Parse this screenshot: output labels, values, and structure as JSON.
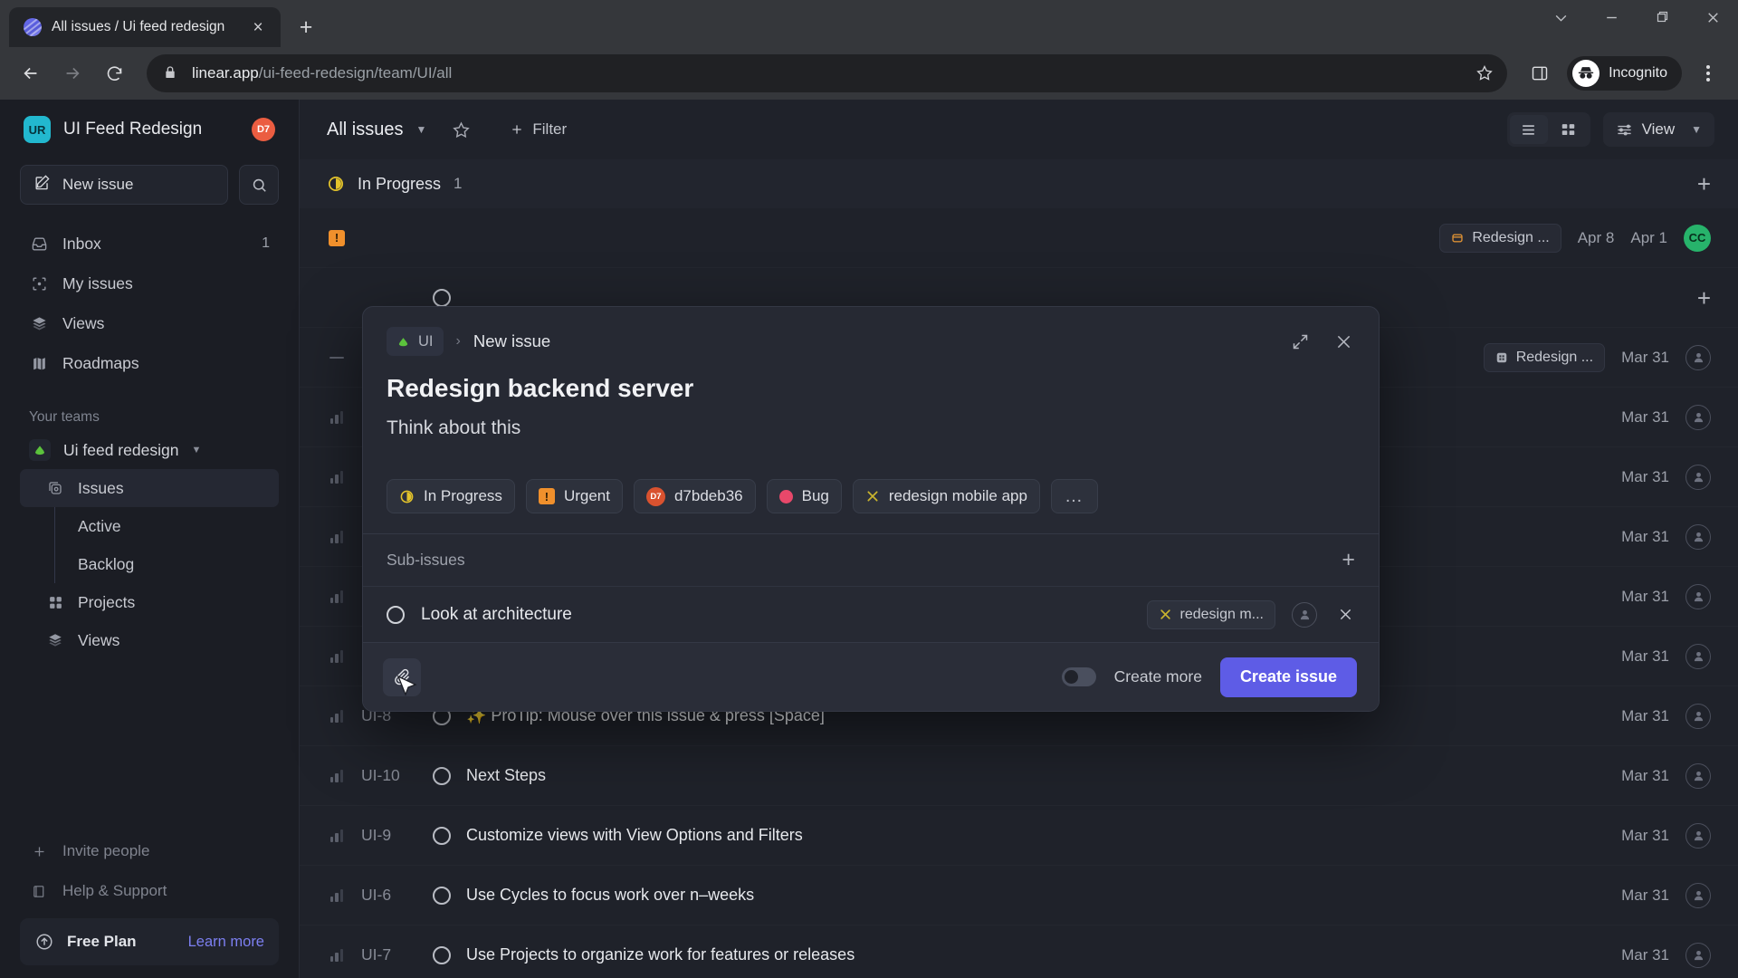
{
  "browser": {
    "tab": {
      "title": "All issues / Ui feed redesign",
      "favicon": "linear-logo-icon",
      "close": "×"
    },
    "new_tab_label": "+",
    "window_controls": [
      "chevron-down-icon",
      "minimize-icon",
      "maximize-icon",
      "close-icon"
    ],
    "nav": {
      "back": "back-arrow-icon",
      "forward": "forward-arrow-icon",
      "reload": "reload-icon"
    },
    "url": {
      "domain": "linear.app",
      "path": "/ui-feed-redesign/team/UI/all"
    },
    "star": "bookmark-star-icon",
    "side_panel": "side-panel-icon",
    "profile": {
      "label": "Incognito",
      "icon": "incognito-icon"
    },
    "menu": "three-dot-menu-icon"
  },
  "sidebar": {
    "workspace": {
      "initials": "UR",
      "name": "UI Feed Redesign",
      "badge": "D7"
    },
    "new_issue_label": "New issue",
    "search_icon": "search-icon",
    "nav_items": [
      {
        "label": "Inbox",
        "icon": "inbox-icon",
        "count": "1"
      },
      {
        "label": "My issues",
        "icon": "my-issues-icon",
        "count": ""
      },
      {
        "label": "Views",
        "icon": "views-icon",
        "count": ""
      },
      {
        "label": "Roadmaps",
        "icon": "roadmaps-icon",
        "count": ""
      }
    ],
    "teams_section_label": "Your teams",
    "team": {
      "name": "Ui feed redesign",
      "icon": "team-logo-icon"
    },
    "team_items": [
      {
        "label": "Issues",
        "icon": "issues-icon",
        "active": true
      },
      {
        "label": "Active",
        "icon": "",
        "leaf": true
      },
      {
        "label": "Backlog",
        "icon": "",
        "leaf": true
      },
      {
        "label": "Projects",
        "icon": "projects-icon"
      },
      {
        "label": "Views",
        "icon": "views-icon"
      }
    ],
    "bottom_items": [
      {
        "label": "Invite people",
        "icon": "plus-icon"
      },
      {
        "label": "Help & Support",
        "icon": "book-icon"
      }
    ],
    "plan": {
      "name": "Free Plan",
      "link": "Learn more",
      "icon": "upgrade-arrow-icon"
    }
  },
  "toolbar": {
    "view_title": "All issues",
    "caret": "chevron-down-icon",
    "favorite_icon": "star-icon",
    "filter_label": "Filter",
    "filter_icon": "plus-icon",
    "list_view_icon": "list-view-icon",
    "board_view_icon": "board-view-icon",
    "view_label": "View",
    "view_icon": "sliders-icon"
  },
  "group": {
    "label": "In Progress",
    "count": "1",
    "icon": "in-progress-icon",
    "add": "+"
  },
  "rows": [
    {
      "prio": "urgent",
      "id": "",
      "status": "in-progress",
      "title": "",
      "project": "Redesign ...",
      "cycle": "Apr 8",
      "date": "Apr 1",
      "avatar": "CC",
      "hidden_title": true
    },
    {
      "prio": "none",
      "id": "",
      "status": "open",
      "title": "",
      "project": "",
      "cycle": "",
      "date": "",
      "avatar": "",
      "spacer": true
    },
    {
      "prio": "none-dash",
      "id": "",
      "status": "open",
      "title": "",
      "project": "Redesign ...",
      "cycle": "",
      "date": "Mar 31",
      "avatar": ""
    },
    {
      "prio": "low",
      "id": "",
      "status": "open",
      "title": "",
      "project": "",
      "cycle": "",
      "date": "Mar 31",
      "avatar": ""
    },
    {
      "prio": "low",
      "id": "",
      "status": "open",
      "title": "",
      "project": "",
      "cycle": "",
      "date": "Mar 31",
      "avatar": ""
    },
    {
      "prio": "low",
      "id": "",
      "status": "open",
      "title": "",
      "project": "",
      "cycle": "",
      "date": "Mar 31",
      "avatar": ""
    },
    {
      "prio": "low",
      "id": "",
      "status": "open",
      "title": "",
      "project": "",
      "cycle": "",
      "date": "Mar 31",
      "avatar": ""
    },
    {
      "prio": "low",
      "id": "",
      "status": "open",
      "title": "",
      "project": "",
      "cycle": "",
      "date": "Mar 31",
      "avatar": ""
    },
    {
      "prio": "low",
      "id": "UI-8",
      "status": "open",
      "title": "✨ ProTip: Mouse over this issue & press [Space]",
      "project": "",
      "cycle": "",
      "date": "Mar 31",
      "avatar": ""
    },
    {
      "prio": "low",
      "id": "UI-10",
      "status": "open",
      "title": "Next Steps",
      "project": "",
      "cycle": "",
      "date": "Mar 31",
      "avatar": ""
    },
    {
      "prio": "low",
      "id": "UI-9",
      "status": "open",
      "title": "Customize views with View Options and Filters",
      "project": "",
      "cycle": "",
      "date": "Mar 31",
      "avatar": ""
    },
    {
      "prio": "low",
      "id": "UI-6",
      "status": "open",
      "title": "Use Cycles to focus work over n–weeks",
      "project": "",
      "cycle": "",
      "date": "Mar 31",
      "avatar": ""
    },
    {
      "prio": "low",
      "id": "UI-7",
      "status": "open",
      "title": "Use Projects to organize work for features or releases",
      "project": "",
      "cycle": "",
      "date": "Mar 31",
      "avatar": ""
    }
  ],
  "modal": {
    "breadcrumb_team": "UI",
    "breadcrumb_sep": "›",
    "breadcrumb_current": "New issue",
    "expand_icon": "expand-icon",
    "close_icon": "close-icon",
    "title": "Redesign backend server",
    "description": "Think about this",
    "properties": [
      {
        "label": "In Progress",
        "icon": "in-progress-icon"
      },
      {
        "label": "Urgent",
        "icon": "urgent-icon"
      },
      {
        "label": "d7bdeb36",
        "icon": "assignee-avatar",
        "avatar_text": "D7"
      },
      {
        "label": "Bug",
        "icon": "label-dot-icon"
      },
      {
        "label": "redesign mobile app",
        "icon": "project-icon"
      },
      {
        "label": "…",
        "icon": "more-icon"
      }
    ],
    "subissues": {
      "header": "Sub-issues",
      "add": "+",
      "items": [
        {
          "title": "Look at architecture",
          "chip": "redesign m...",
          "chip_icon": "project-icon",
          "assignee_icon": "assignee-placeholder-icon",
          "remove_icon": "close-icon"
        }
      ]
    },
    "footer": {
      "attach_icon": "paperclip-icon",
      "create_more_label": "Create more",
      "create_more_on": false,
      "create_button": "Create issue",
      "accent": "#5e5ce6"
    }
  }
}
